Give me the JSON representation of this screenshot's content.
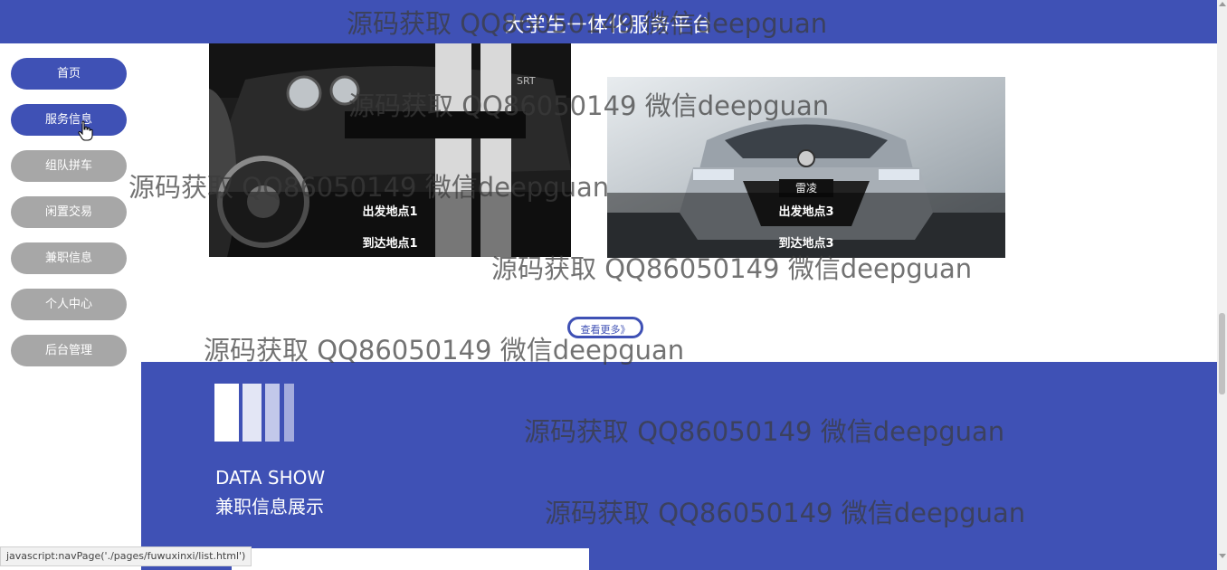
{
  "header": {
    "title": "大学生一体化服务平台"
  },
  "sidebar": {
    "items": [
      {
        "label": "首页",
        "active": true
      },
      {
        "label": "服务信息",
        "active": true
      },
      {
        "label": "组队拼车",
        "active": false
      },
      {
        "label": "闲置交易",
        "active": false
      },
      {
        "label": "兼职信息",
        "active": false
      },
      {
        "label": "个人中心",
        "active": false
      },
      {
        "label": "后台管理",
        "active": false
      }
    ]
  },
  "cards": [
    {
      "from": "出发地点1",
      "to": "到达地点1",
      "badge": "SRT"
    },
    {
      "from": "出发地点3",
      "to": "到达地点3",
      "badge": "雷凌"
    }
  ],
  "more_button": {
    "label": "查看更多》"
  },
  "data_show": {
    "title": "DATA SHOW",
    "subtitle": "兼职信息展示"
  },
  "watermark": {
    "text": "源码获取 QQ86050149 微信deepguan"
  },
  "status_bar": {
    "url": "javascript:navPage('./pages/fuwuxinxi/list.html')"
  },
  "colors": {
    "primary": "#3f51b5",
    "inactive": "#a7a7a7"
  }
}
